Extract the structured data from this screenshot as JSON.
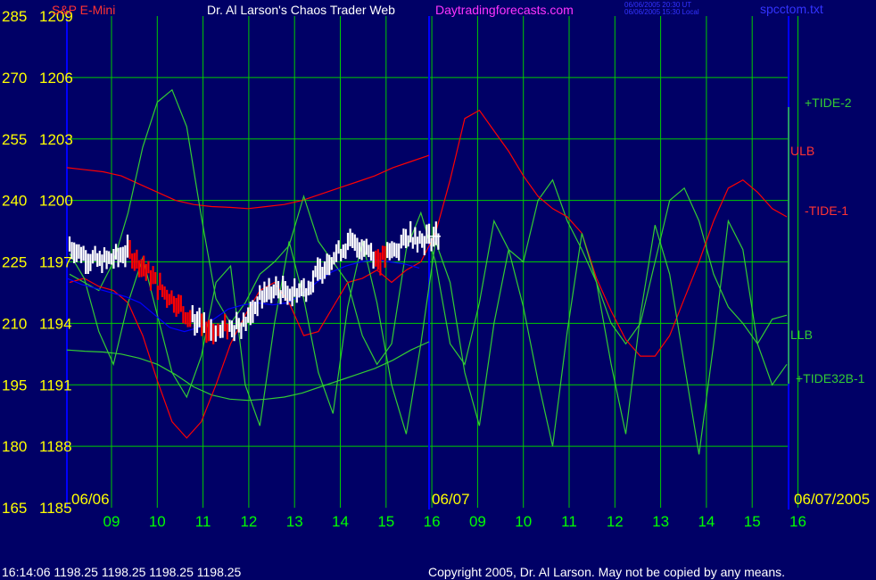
{
  "header": {
    "instrument": "S&P E-Mini",
    "title": "Dr. Al Larson's Chaos Trader Web",
    "site": "Daytradingforecasts.com",
    "stamp_line1": "06/06/2005 20:30 UT",
    "stamp_line2": "06/06/2005 15:30 Local",
    "file": "spcctom.txt"
  },
  "footer": {
    "quote": "16:14:06  1198.25 1198.25 1198.25 1198.25",
    "copyright": "Copyright 2005, Dr. Al Larson. May not be copied by any means."
  },
  "colors": {
    "background": "#000066",
    "grid": "#00cc00",
    "yellow": "#ffff00",
    "red": "#ff0000",
    "green": "#33cc33",
    "blue": "#0000ff",
    "white": "#ffffff",
    "magenta": "#ff33ff"
  },
  "chart_data": {
    "type": "line",
    "y_left_ticks": [
      "285",
      "270",
      "255",
      "240",
      "225",
      "210",
      "195",
      "180",
      "165"
    ],
    "y_right_ticks": [
      "1209",
      "1206",
      "1203",
      "1200",
      "1197",
      "1194",
      "1191",
      "1188",
      "1185"
    ],
    "ylim_price": [
      1185,
      1209
    ],
    "ylim_index": [
      165,
      285
    ],
    "x_hour_ticks": [
      "09",
      "10",
      "11",
      "12",
      "13",
      "14",
      "15",
      "16",
      "09",
      "10",
      "11",
      "12",
      "13",
      "14",
      "15",
      "16"
    ],
    "date_labels": [
      "06/06",
      "06/07",
      "06/07/2005"
    ],
    "series_labels": [
      "+TIDE-2",
      "ULB",
      "-TIDE-1",
      "LLB",
      "+TIDE32B-1"
    ],
    "series": [
      {
        "name": "ULB",
        "color": "red",
        "y": [
          248,
          247.5,
          247,
          246,
          244,
          242,
          240,
          239,
          238.5,
          238.3,
          238,
          238.5,
          239,
          240,
          241.5,
          243,
          244.5,
          246,
          248,
          249.5,
          251
        ]
      },
      {
        "name": "LLB",
        "color": "green",
        "y": [
          203.5,
          203.2,
          203,
          202.5,
          201.5,
          200,
          197.5,
          194.5,
          192.5,
          191.5,
          191.2,
          191.5,
          192,
          193,
          194.5,
          196,
          197.5,
          199,
          201,
          203.5,
          205.5
        ]
      },
      {
        "name": "+TIDE-2",
        "color": "green",
        "y": [
          222,
          220,
          218,
          225,
          237,
          253,
          264,
          267,
          258,
          236,
          216,
          210,
          215,
          222,
          225,
          229,
          241,
          230,
          225,
          220,
          207,
          200,
          205,
          228,
          237,
          225,
          205,
          200,
          215,
          235,
          228,
          225,
          240,
          245,
          235,
          228,
          220,
          210,
          205,
          210,
          225,
          240,
          243,
          235,
          222,
          214,
          210,
          205,
          211,
          212
        ]
      },
      {
        "name": "-TIDE-1",
        "color": "red",
        "y": [
          220,
          221,
          219,
          218,
          215,
          207,
          196,
          186,
          182,
          186,
          195,
          205,
          212,
          218,
          220,
          215,
          207,
          208,
          214,
          220,
          221,
          223,
          220,
          223,
          225,
          232,
          245,
          260,
          262,
          257,
          252,
          246,
          241,
          238,
          236,
          232,
          221,
          213,
          206,
          202,
          202,
          207,
          216,
          225,
          235,
          243,
          245,
          242,
          238,
          236
        ]
      },
      {
        "name": "+TIDE32B-1",
        "color": "green",
        "y": [
          227,
          221,
          208,
          200,
          215,
          226,
          212,
          198,
          192,
          202,
          220,
          224,
          195,
          185,
          210,
          230,
          216,
          198,
          188,
          214,
          230,
          215,
          195,
          183,
          205,
          230,
          220,
          198,
          185,
          210,
          228,
          214,
          196,
          180,
          208,
          232,
          220,
          200,
          183,
          212,
          234,
          222,
          200,
          178,
          205,
          235,
          228,
          205,
          195,
          200
        ]
      },
      {
        "name": "MA",
        "color": "blue",
        "y": [
          221,
          219.5,
          218.5,
          217.5,
          216.5,
          215,
          212,
          209,
          208,
          209,
          211,
          213.5,
          214.5,
          215,
          214.5,
          215,
          217,
          220,
          222.5,
          224,
          225,
          225.5,
          225,
          224.5,
          223.5
        ]
      },
      {
        "name": "Price",
        "color": "white",
        "y": [
          1197.8,
          1197.3,
          1197,
          1197.2,
          1197.5,
          1196.8,
          1195.8,
          1195.2,
          1194.4,
          1193.8,
          1193.6,
          1193.9,
          1194.1,
          1195.4,
          1195.6,
          1195.5,
          1195.7,
          1196.6,
          1197.4,
          1197.9,
          1197.7,
          1197.1,
          1197.6,
          1198.3,
          1198.1,
          1198.25
        ]
      }
    ]
  }
}
